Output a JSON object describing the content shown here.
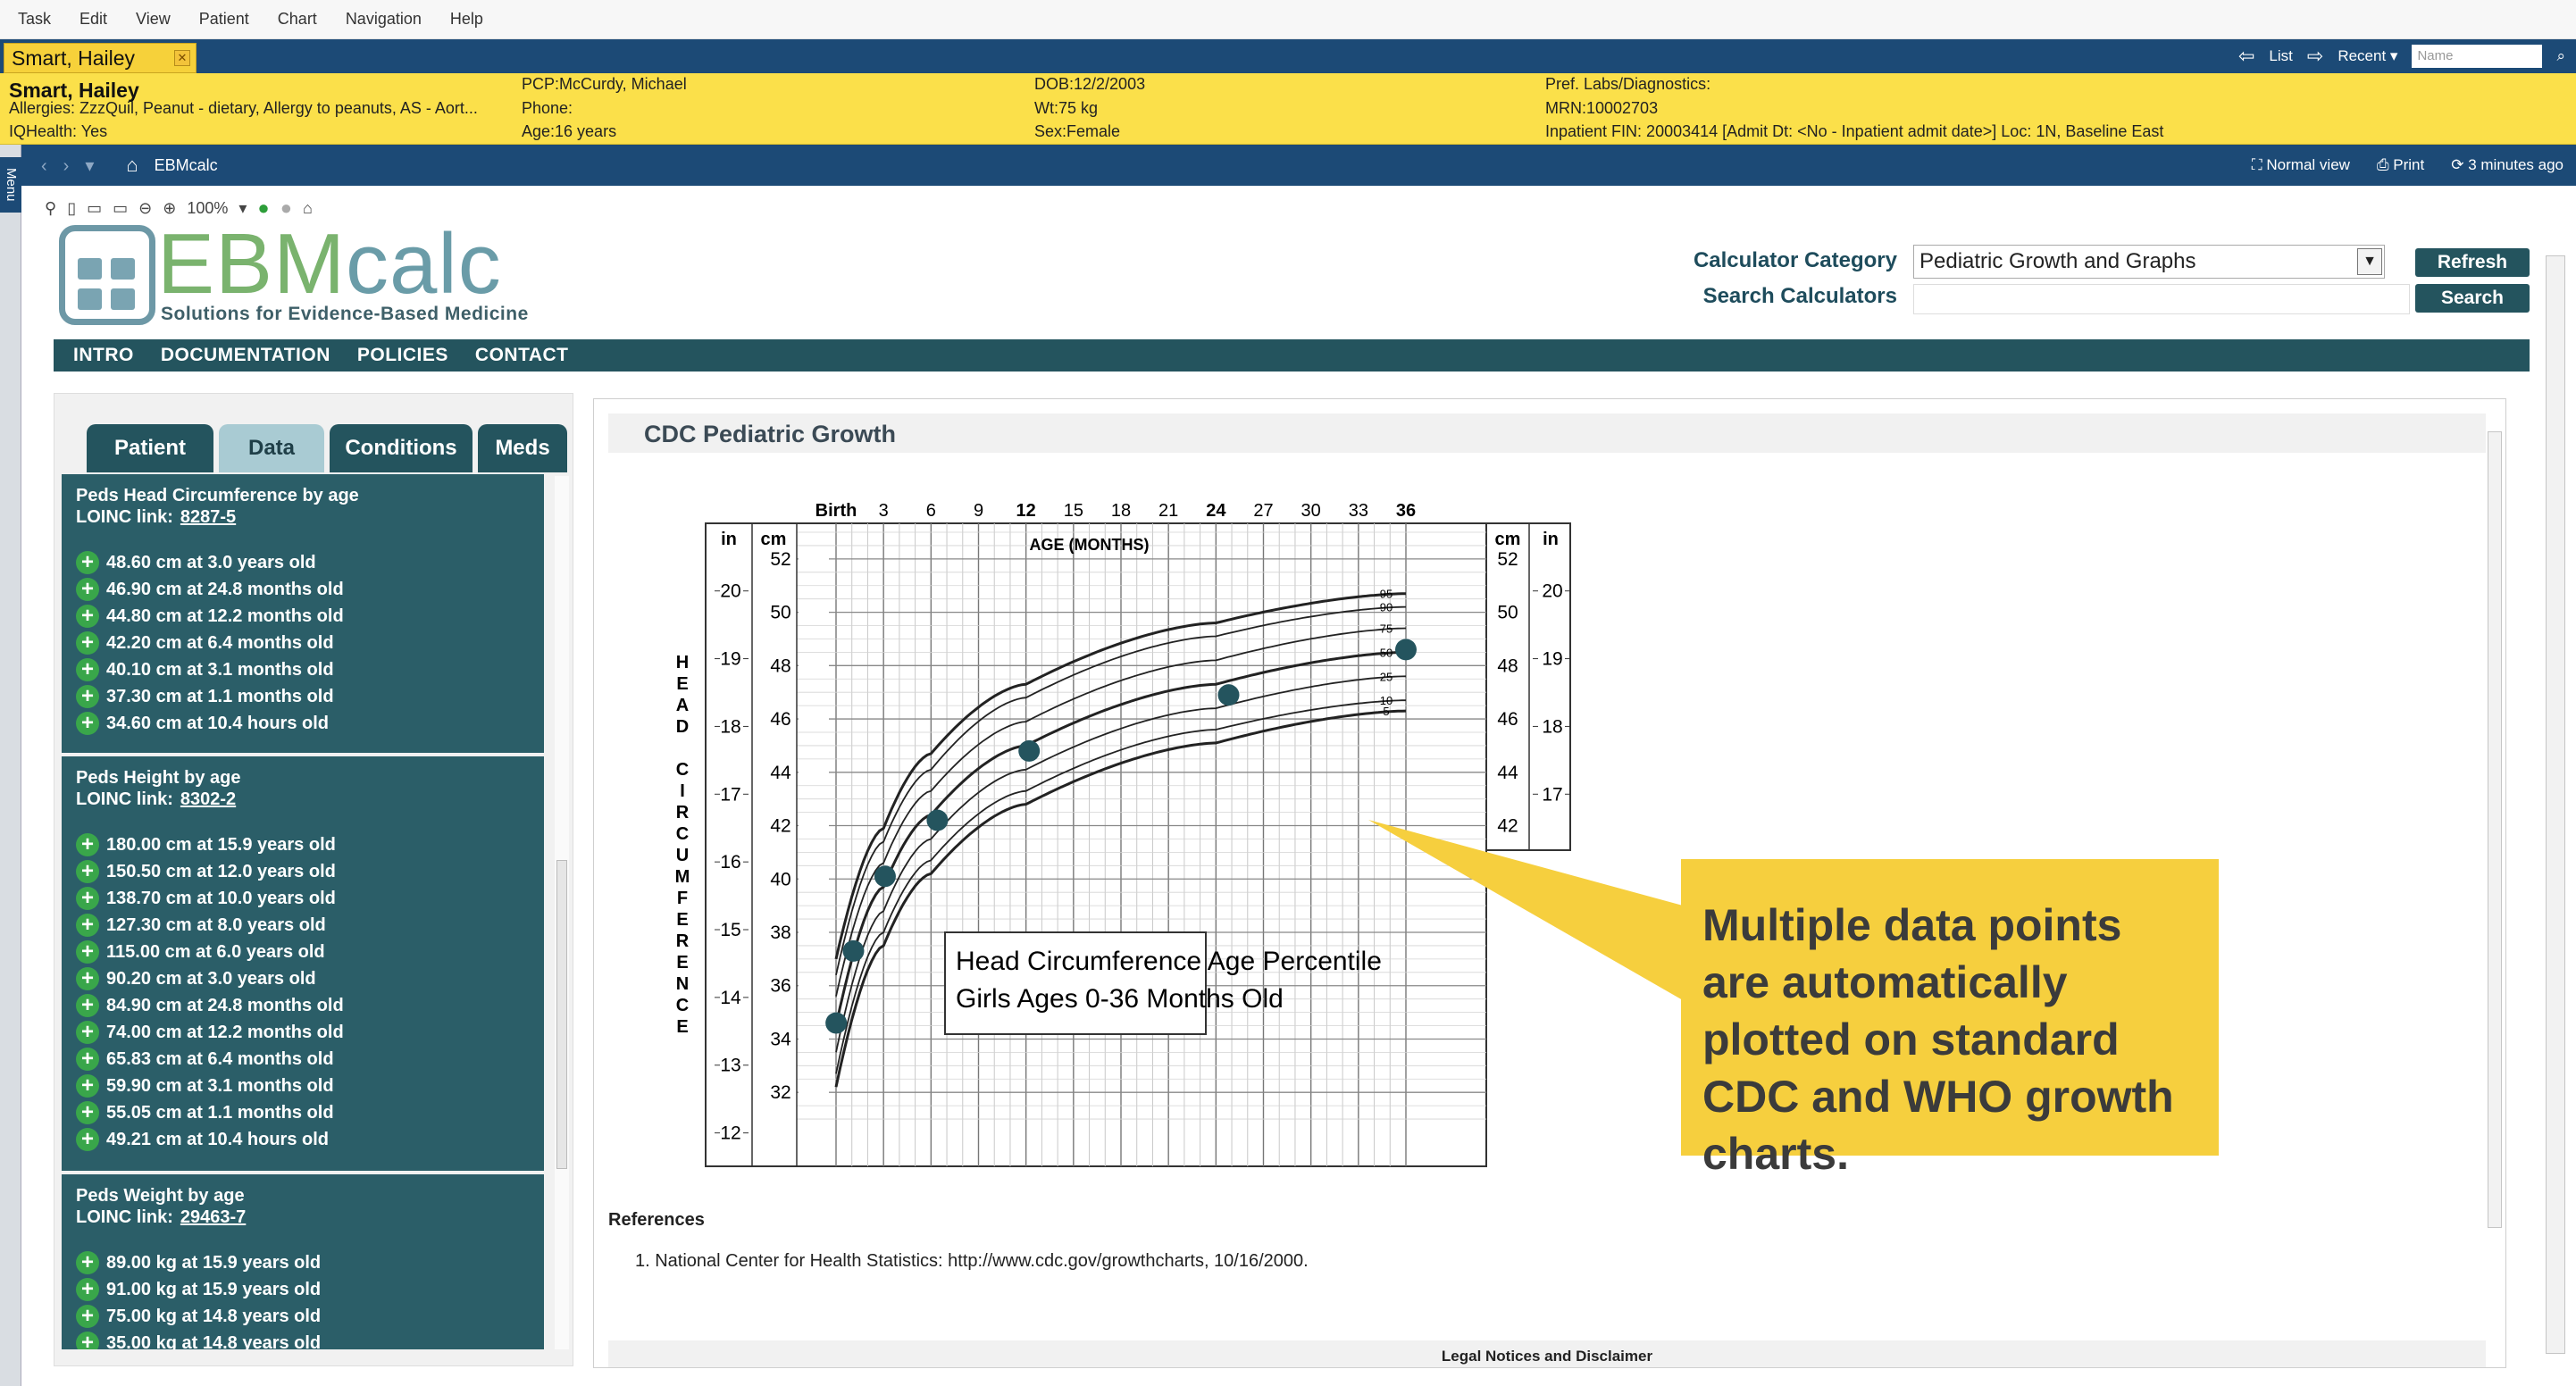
{
  "menu": [
    "Task",
    "Edit",
    "View",
    "Patient",
    "Chart",
    "Navigation",
    "Help"
  ],
  "patient_tab": "Smart, Hailey",
  "tabbar": {
    "list": "List",
    "recent": "Recent",
    "name_placeholder": "Name"
  },
  "banner": {
    "name": "Smart, Hailey",
    "allergies": "Allergies: ZzzQuil, Peanut - dietary, Allergy to peanuts, AS - Aort...",
    "iqhealth": "IQHealth: Yes",
    "pcp": "PCP:McCurdy, Michael",
    "phone": "Phone:",
    "age": "Age:16 years",
    "dob": "DOB:12/2/2003",
    "wt": "Wt:75 kg",
    "sex": "Sex:Female",
    "labs": "Pref. Labs/Diagnostics:",
    "mrn": "MRN:10002703",
    "inpatient": "Inpatient  FIN: 20003414 [Admit Dt: <No - Inpatient admit date>] Loc: 1N, Baseline East"
  },
  "side_menu": "Menu",
  "nav": {
    "title": "EBMcalc",
    "normal_view": "Normal view",
    "print": "Print",
    "updated": "3 minutes ago"
  },
  "toolbar": {
    "zoom": "100%"
  },
  "logo": {
    "ebm": "EBM",
    "calc": "calc",
    "tagline": "Solutions for Evidence-Based Medicine"
  },
  "calculator": {
    "category_label": "Calculator Category",
    "category_value": "Pediatric Growth and Graphs",
    "search_label": "Search Calculators",
    "refresh": "Refresh",
    "search": "Search"
  },
  "main_nav": [
    "INTRO",
    "DOCUMENTATION",
    "POLICIES",
    "CONTACT"
  ],
  "left_tabs": [
    "Patient",
    "Data",
    "Conditions",
    "Meds"
  ],
  "sections": [
    {
      "title": "Peds Head Circumference by age",
      "loinc_label": "LOINC link:",
      "loinc": "8287-5",
      "items": [
        "48.60 cm at 3.0 years old",
        "46.90 cm at 24.8 months old",
        "44.80 cm at 12.2 months old",
        "42.20 cm at 6.4 months old",
        "40.10 cm at 3.1 months old",
        "37.30 cm at 1.1 months old",
        "34.60 cm at 10.4 hours old"
      ]
    },
    {
      "title": "Peds Height by age",
      "loinc_label": "LOINC link:",
      "loinc": "8302-2",
      "items": [
        "180.00 cm at 15.9 years old",
        "150.50 cm at 12.0 years old",
        "138.70 cm at 10.0 years old",
        "127.30 cm at 8.0 years old",
        "115.00 cm at 6.0 years old",
        "90.20 cm at 3.0 years old",
        "84.90 cm at 24.8 months old",
        "74.00 cm at 12.2 months old",
        "65.83 cm at 6.4 months old",
        "59.90 cm at 3.1 months old",
        "55.05 cm at 1.1 months old",
        "49.21 cm at 10.4 hours old"
      ]
    },
    {
      "title": "Peds Weight by age",
      "loinc_label": "LOINC link:",
      "loinc": "29463-7",
      "items": [
        "89.00 kg at 15.9 years old",
        "91.00 kg at 15.9 years old",
        "75.00 kg at 14.8 years old",
        "35.00 kg at 14.8 years old"
      ]
    }
  ],
  "content": {
    "title": "CDC Pediatric Growth",
    "references_heading": "References",
    "reference_1": "1.  National Center for Health Statistics: http://www.cdc.gov/growthcharts, 10/16/2000.",
    "legal": "Legal Notices and Disclaimer"
  },
  "chart_data": {
    "type": "line",
    "title": "Head Circumference Age Percentile",
    "subtitle": "Girls Ages 0-36 Months Old",
    "xlabel": "AGE (MONTHS)",
    "ylabel": "HEAD CIRCUMFERENCE",
    "x_ticks": [
      "Birth",
      "3",
      "6",
      "9",
      "12",
      "15",
      "18",
      "21",
      "24",
      "27",
      "30",
      "33",
      "36"
    ],
    "y_cm_ticks": [
      "32",
      "34",
      "36",
      "38",
      "40",
      "42",
      "44",
      "46",
      "48",
      "50",
      "52"
    ],
    "y_in_ticks": [
      "12",
      "13",
      "14",
      "15",
      "16",
      "17",
      "18",
      "19",
      "20"
    ],
    "left_units": [
      "in",
      "cm"
    ],
    "right_units": [
      "cm",
      "in"
    ],
    "xlim": [
      0,
      36
    ],
    "ylim_cm": [
      30.5,
      53
    ],
    "percentiles": [
      {
        "name": "5",
        "values": [
          [
            0,
            32.2
          ],
          [
            3,
            37.5
          ],
          [
            6,
            40.2
          ],
          [
            12,
            42.8
          ],
          [
            24,
            45.1
          ],
          [
            36,
            46.3
          ]
        ]
      },
      {
        "name": "10",
        "values": [
          [
            0,
            32.7
          ],
          [
            3,
            38.0
          ],
          [
            6,
            40.7
          ],
          [
            12,
            43.3
          ],
          [
            24,
            45.6
          ],
          [
            36,
            46.7
          ]
        ]
      },
      {
        "name": "25",
        "values": [
          [
            0,
            33.5
          ],
          [
            3,
            38.8
          ],
          [
            6,
            41.5
          ],
          [
            12,
            44.1
          ],
          [
            24,
            46.4
          ],
          [
            36,
            47.6
          ]
        ]
      },
      {
        "name": "50",
        "values": [
          [
            0,
            34.5
          ],
          [
            3,
            39.7
          ],
          [
            6,
            42.4
          ],
          [
            12,
            45.0
          ],
          [
            24,
            47.3
          ],
          [
            36,
            48.5
          ]
        ]
      },
      {
        "name": "75",
        "values": [
          [
            0,
            35.6
          ],
          [
            3,
            40.6
          ],
          [
            6,
            43.3
          ],
          [
            12,
            45.9
          ],
          [
            24,
            48.2
          ],
          [
            36,
            49.4
          ]
        ]
      },
      {
        "name": "90",
        "values": [
          [
            0,
            36.4
          ],
          [
            3,
            41.4
          ],
          [
            6,
            44.1
          ],
          [
            12,
            46.8
          ],
          [
            24,
            49.1
          ],
          [
            36,
            50.2
          ]
        ]
      },
      {
        "name": "95",
        "values": [
          [
            0,
            37.0
          ],
          [
            3,
            41.9
          ],
          [
            6,
            44.7
          ],
          [
            12,
            47.3
          ],
          [
            24,
            49.6
          ],
          [
            36,
            50.7
          ]
        ]
      }
    ],
    "points": [
      [
        0.01,
        34.6
      ],
      [
        1.1,
        37.3
      ],
      [
        3.1,
        40.1
      ],
      [
        6.4,
        42.2
      ],
      [
        12.2,
        44.8
      ],
      [
        24.8,
        46.9
      ],
      [
        36,
        48.6
      ]
    ],
    "point_color": "#24545e"
  },
  "callout": "Multiple data points are automatically plotted on standard CDC and WHO growth charts.",
  "colors": {
    "nav": "#1c4a76",
    "banner": "#fbe04a",
    "teal": "#24545e",
    "callout": "#f6cf3e"
  }
}
